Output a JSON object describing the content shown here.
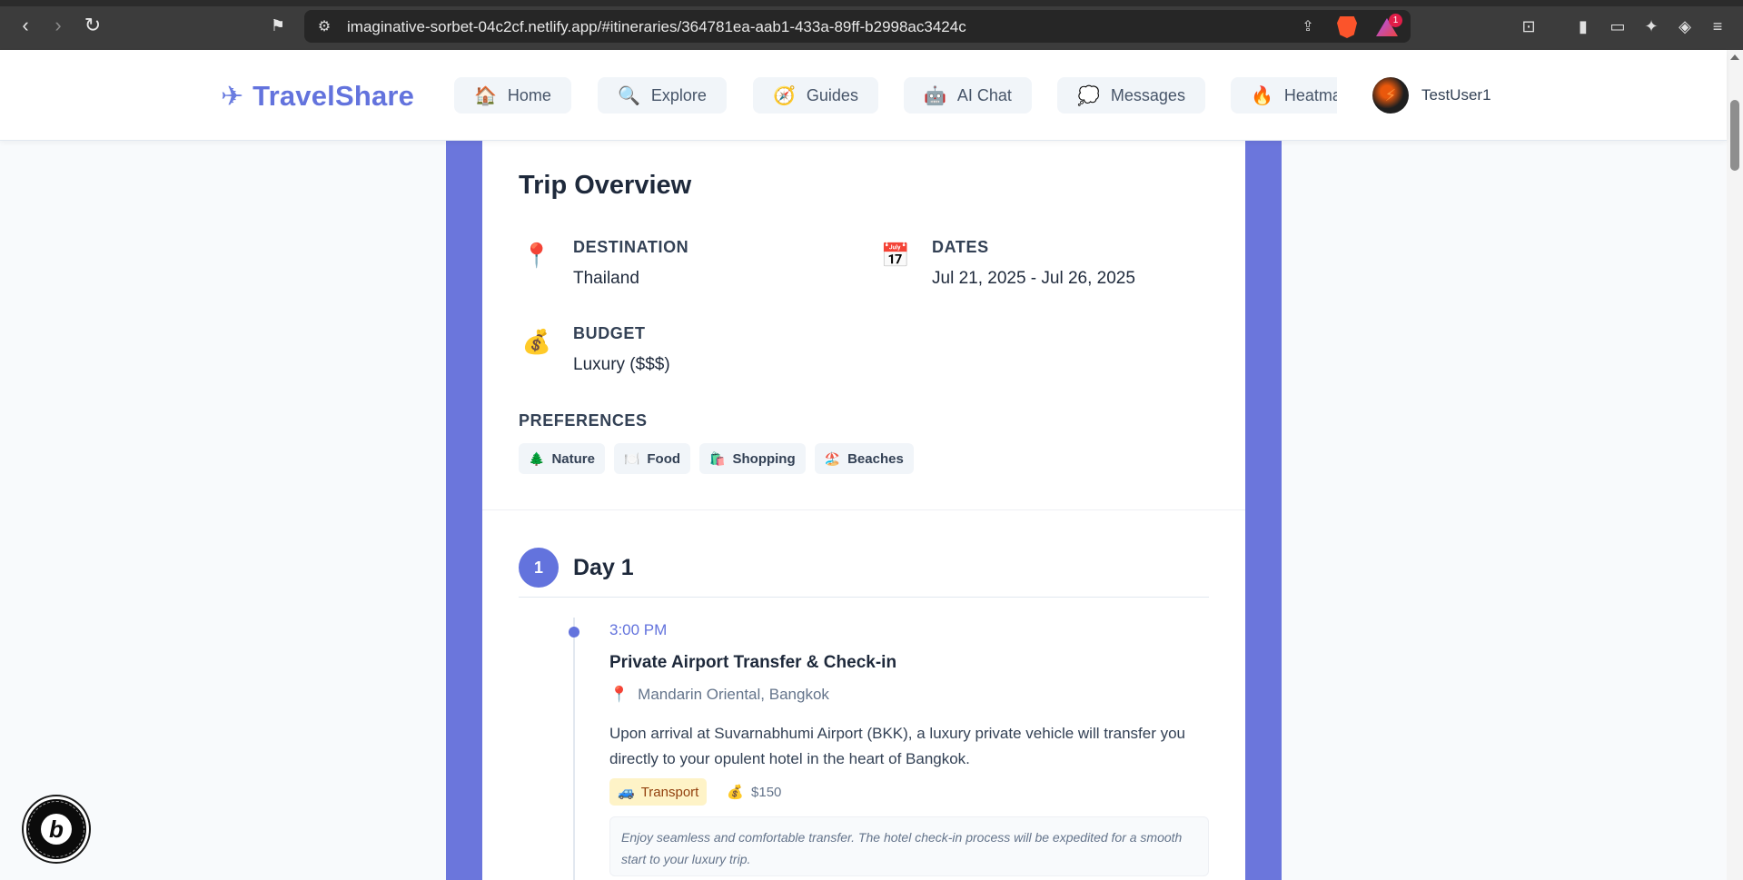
{
  "browser": {
    "url": "imaginative-sorbet-04c2cf.netlify.app/#itineraries/364781ea-aab1-433a-89ff-b2998ac3424c",
    "rewards_badge": "1"
  },
  "app": {
    "logo_text": "TravelShare",
    "nav": [
      {
        "icon": "🏠",
        "label": "Home"
      },
      {
        "icon": "🔍",
        "label": "Explore"
      },
      {
        "icon": "🧭",
        "label": "Guides"
      },
      {
        "icon": "🤖",
        "label": "AI Chat"
      },
      {
        "icon": "💭",
        "label": "Messages"
      },
      {
        "icon": "🔥",
        "label": "Heatmap"
      }
    ],
    "user_name": "TestUser1"
  },
  "overview": {
    "title": "Trip Overview",
    "destination": {
      "icon": "📍",
      "label": "DESTINATION",
      "value": "Thailand"
    },
    "dates": {
      "icon": "📅",
      "label": "DATES",
      "value": "Jul 21, 2025 - Jul 26, 2025"
    },
    "budget": {
      "icon": "💰",
      "label": "BUDGET",
      "value": "Luxury ($$$)"
    },
    "preferences_label": "PREFERENCES",
    "preferences": [
      {
        "icon": "🌲",
        "label": "Nature"
      },
      {
        "icon": "🍽️",
        "label": "Food"
      },
      {
        "icon": "🛍️",
        "label": "Shopping"
      },
      {
        "icon": "🏖️",
        "label": "Beaches"
      }
    ]
  },
  "day": {
    "number": "1",
    "title": "Day 1",
    "activity": {
      "time": "3:00 PM",
      "title": "Private Airport Transfer & Check-in",
      "location_icon": "📍",
      "location": "Mandarin Oriental, Bangkok",
      "description": "Upon arrival at Suvarnabhumi Airport (BKK), a luxury private vehicle will transfer you directly to your opulent hotel in the heart of Bangkok.",
      "category_icon": "🚙",
      "category": "Transport",
      "cost_icon": "💰",
      "cost": "$150",
      "note": "Enjoy seamless and comfortable transfer. The hotel check-in process will be expedited for a smooth start to your luxury trip."
    }
  },
  "colors": {
    "accent": "#6373dd",
    "band": "#6b76dc",
    "badge_bg": "#fef3c7"
  }
}
